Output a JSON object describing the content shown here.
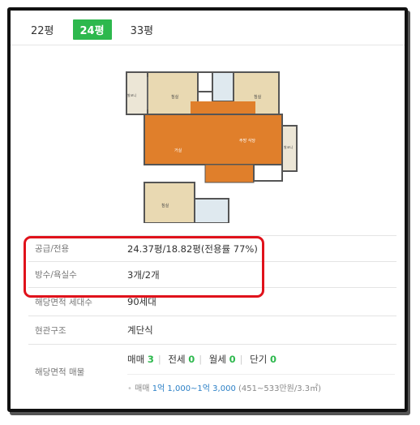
{
  "tabs": [
    {
      "label": "22평",
      "active": false
    },
    {
      "label": "24평",
      "active": true
    },
    {
      "label": "33평",
      "active": false
    }
  ],
  "floorplan": {
    "rooms": [
      "침실",
      "침실",
      "발코니",
      "거실",
      "주방 식당",
      "발코니",
      "침실"
    ]
  },
  "info": {
    "supply_label": "공급/전용",
    "supply_value": "24.37평/18.82평(전용률 77%)",
    "rooms_label": "방수/욕실수",
    "rooms_value": "3개/2개",
    "households_label": "해당면적 세대수",
    "households_value": "90세대",
    "entrance_label": "현관구조",
    "entrance_value": "계단식",
    "listings_label": "해당면적 매물",
    "sale_label": "매매",
    "sale_count": "3",
    "jeonse_label": "전세",
    "jeonse_count": "0",
    "monthly_label": "월세",
    "monthly_count": "0",
    "short_label": "단기",
    "short_count": "0",
    "price_prefix": "매매",
    "price_range": "1억 1,000~1억 3,000",
    "price_unit": "(451~533만원/3.3㎡)"
  },
  "colors": {
    "accent_green": "#2db84d",
    "highlight_red": "#e0121b",
    "price_blue": "#2a7fc6"
  }
}
